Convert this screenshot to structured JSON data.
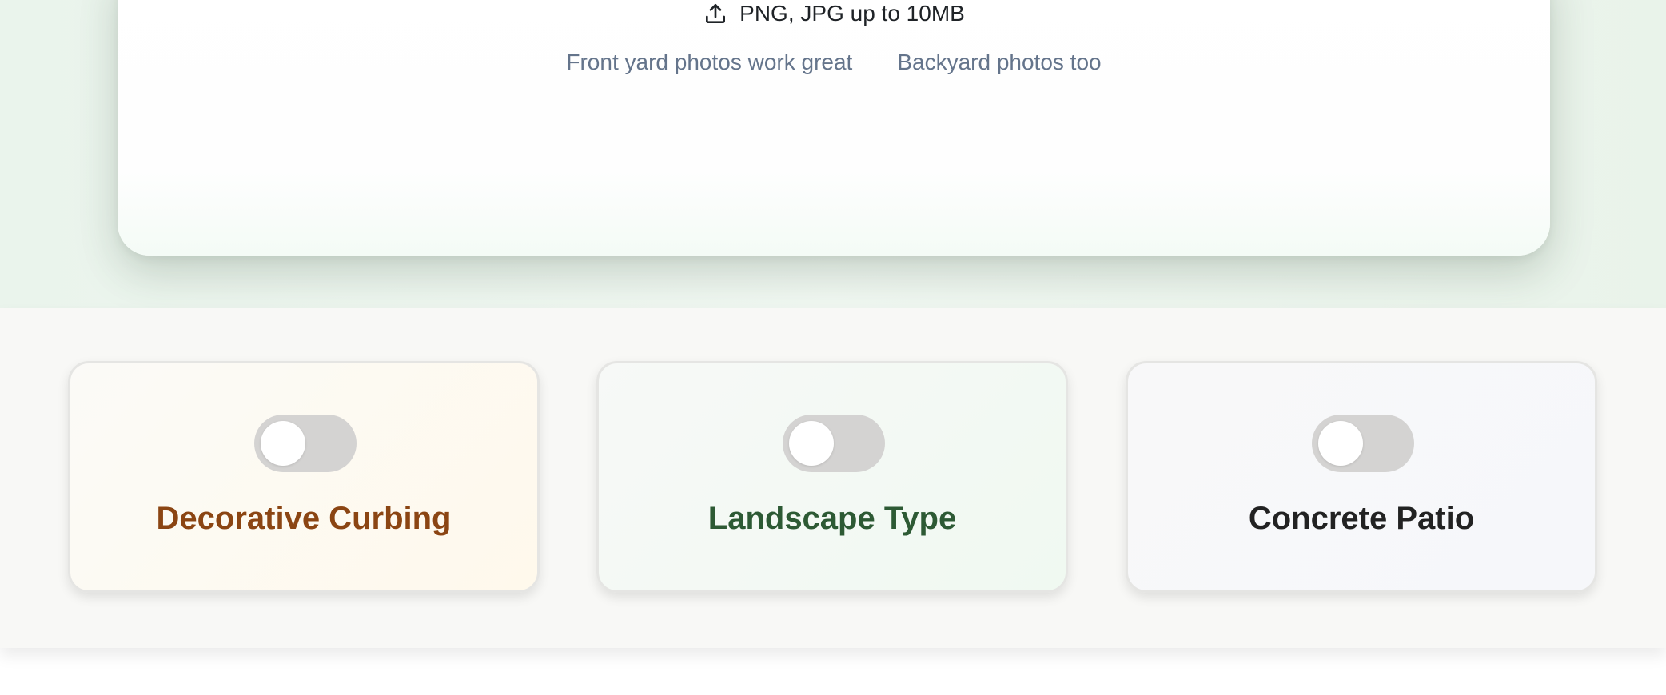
{
  "upload": {
    "formats_text": "PNG, JPG up to 10MB",
    "formats_icon": "upload-icon",
    "hints": [
      "Front yard photos work great",
      "Backyard photos too"
    ]
  },
  "options": [
    {
      "label": "Decorative Curbing",
      "enabled": false,
      "title_color": "#8b4513"
    },
    {
      "label": "Landscape Type",
      "enabled": false,
      "title_color": "#2d5a34"
    },
    {
      "label": "Concrete Patio",
      "enabled": false,
      "title_color": "#222222"
    }
  ],
  "colors": {
    "hint_text": "#64748b",
    "toggle_off": "#d4d3d2"
  }
}
